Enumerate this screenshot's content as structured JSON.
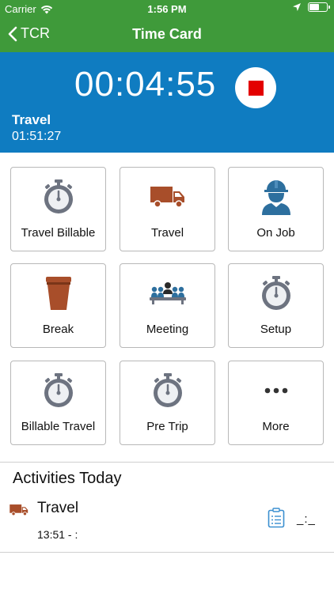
{
  "status_bar": {
    "carrier": "Carrier",
    "time": "1:56 PM"
  },
  "nav": {
    "back_label": "TCR",
    "title": "Time Card"
  },
  "timer": {
    "clock": "00:04:55",
    "current_activity": "Travel",
    "activity_elapsed": "01:51:27",
    "stop_color": "#e30000"
  },
  "tiles": [
    {
      "label": "Travel Billable",
      "icon": "stopwatch-icon"
    },
    {
      "label": "Travel",
      "icon": "truck-icon"
    },
    {
      "label": "On Job",
      "icon": "worker-hardhat-icon"
    },
    {
      "label": "Break",
      "icon": "coffee-cup-icon"
    },
    {
      "label": "Meeting",
      "icon": "meeting-people-icon"
    },
    {
      "label": "Setup",
      "icon": "stopwatch-icon"
    },
    {
      "label": "Billable Travel",
      "icon": "stopwatch-icon"
    },
    {
      "label": "Pre Trip",
      "icon": "stopwatch-icon"
    },
    {
      "label": "More",
      "icon": "more-dots-icon"
    }
  ],
  "activities_section": {
    "title": "Activities Today",
    "items": [
      {
        "name": "Travel",
        "times": "13:51 - :",
        "duration": "_:_"
      }
    ]
  },
  "colors": {
    "nav_green": "#3f9a3a",
    "timer_blue": "#0f7cc1",
    "icon_gray": "#6d7380",
    "truck_brown": "#a84e2a",
    "worker_blue": "#2d6f9e"
  }
}
